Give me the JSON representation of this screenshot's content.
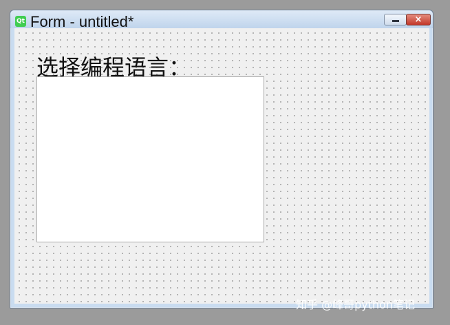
{
  "window": {
    "title": "Form - untitled*",
    "icon_label": "Qt",
    "controls": {
      "minimize": "minimize-icon",
      "close_label": "×"
    }
  },
  "form": {
    "label_text": "选择编程语言："
  },
  "watermark": {
    "text": "知乎 @峰哥python笔记"
  },
  "colors": {
    "desktop": "#9b9b9b",
    "title_bar": "#c9dcf0",
    "close_button": "#c2382a",
    "form_background": "#f0f0f0",
    "list_background": "#ffffff"
  }
}
